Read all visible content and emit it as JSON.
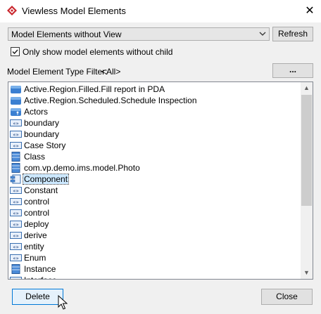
{
  "window": {
    "title": "Viewless Model Elements",
    "accent_color": "#c9252c"
  },
  "toolbar": {
    "combo_value": "Model Elements without View",
    "refresh_label": "Refresh"
  },
  "options": {
    "only_without_child_label": "Only show model elements without child",
    "only_without_child_checked": true
  },
  "filter": {
    "label": "Model Element Type Filter:",
    "value": "<All>",
    "browse_label": "..."
  },
  "list": {
    "items": [
      {
        "label": "Active.Region.Filled.Fill report in PDA",
        "icon": "model-icon"
      },
      {
        "label": "Active.Region.Scheduled.Schedule Inspection",
        "icon": "model-icon"
      },
      {
        "label": "Actors",
        "icon": "actor-model-icon"
      },
      {
        "label": "boundary",
        "icon": "stereotype-icon"
      },
      {
        "label": "boundary",
        "icon": "stereotype-icon"
      },
      {
        "label": "Case Story",
        "icon": "stereotype-icon"
      },
      {
        "label": "Class",
        "icon": "class-icon"
      },
      {
        "label": "com.vp.demo.ims.model.Photo",
        "icon": "class-icon"
      },
      {
        "label": "Component",
        "icon": "component-icon",
        "selected": true
      },
      {
        "label": "Constant",
        "icon": "stereotype-icon"
      },
      {
        "label": "control",
        "icon": "stereotype-icon"
      },
      {
        "label": "control",
        "icon": "stereotype-icon"
      },
      {
        "label": "deploy",
        "icon": "stereotype-icon"
      },
      {
        "label": "derive",
        "icon": "stereotype-icon"
      },
      {
        "label": "entity",
        "icon": "stereotype-icon"
      },
      {
        "label": "Enum",
        "icon": "stereotype-icon"
      },
      {
        "label": "Instance",
        "icon": "class-icon"
      },
      {
        "label": "Interface",
        "icon": "stereotype-icon"
      }
    ]
  },
  "footer": {
    "delete_label": "Delete",
    "close_label": "Close"
  },
  "icons": {
    "close": "close-icon",
    "scroll_up": "▲",
    "scroll_down": "▼"
  }
}
